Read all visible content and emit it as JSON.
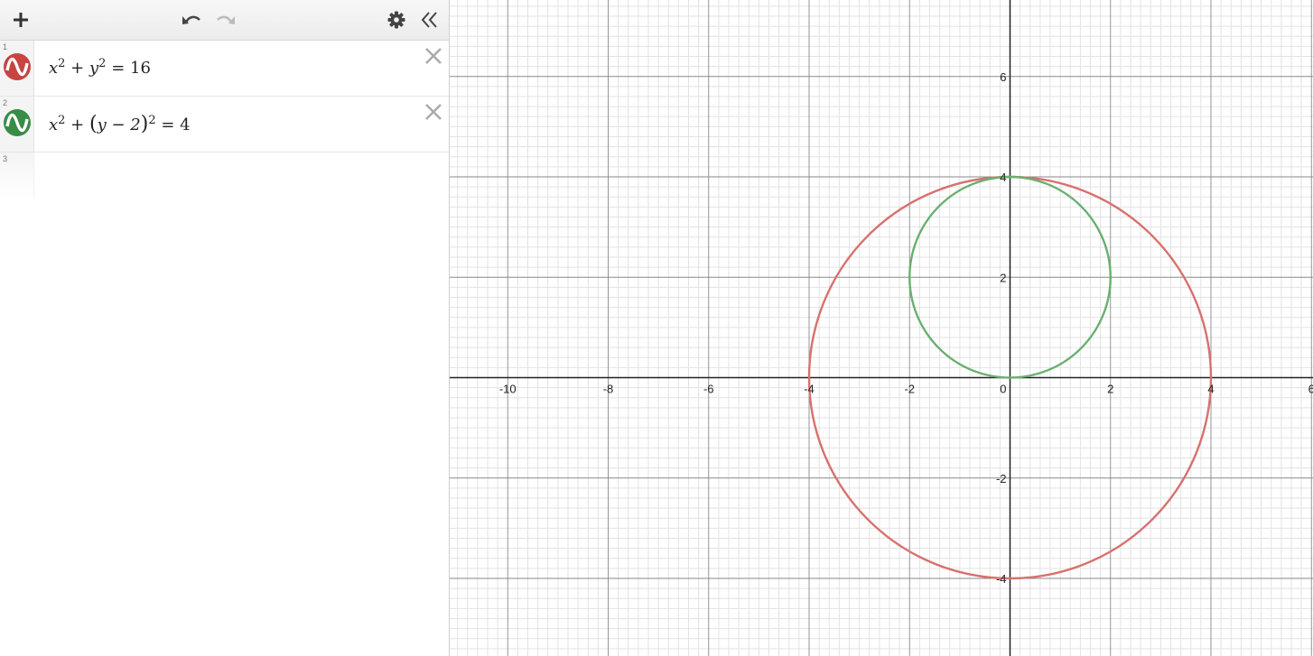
{
  "toolbar": {
    "add_icon": "plus-icon",
    "undo_icon": "undo-icon",
    "redo_icon": "redo-icon",
    "settings_icon": "gear-icon",
    "collapse_icon": "double-chevron-left-icon"
  },
  "expressions": [
    {
      "index": "1",
      "color": "#c74440",
      "lhs_a": "x",
      "exp_a": "2",
      "op": "+",
      "lhs_b": "y",
      "exp_b": "2",
      "rhs": "= 16"
    },
    {
      "index": "2",
      "color": "#388c46",
      "lhs_a": "x",
      "exp_a": "2",
      "op": "+",
      "paren_open": "(",
      "inner": "y − 2",
      "paren_close": ")",
      "exp_b": "2",
      "rhs": "= 4"
    },
    {
      "index": "3"
    }
  ],
  "graph": {
    "x_ticks": [
      "-10",
      "-8",
      "-6",
      "-4",
      "-2",
      "0",
      "2",
      "4",
      "6"
    ],
    "y_ticks": [
      "6",
      "4",
      "2",
      "-2",
      "-4"
    ],
    "curve_colors": {
      "circle_1": "#d7716e",
      "circle_2": "#6aaf70"
    }
  }
}
